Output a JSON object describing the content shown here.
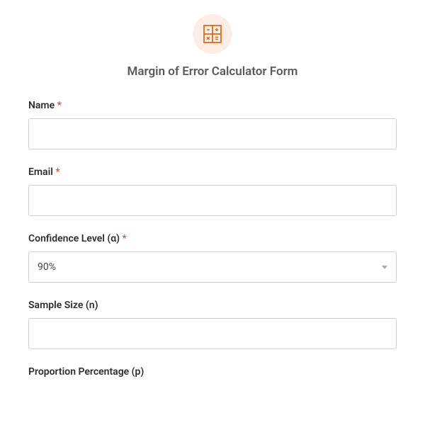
{
  "form": {
    "title": "Margin of Error Calculator Form",
    "fields": {
      "name": {
        "label": "Name",
        "required": true,
        "value": ""
      },
      "email": {
        "label": "Email",
        "required": true,
        "value": ""
      },
      "confidence": {
        "label": "Confidence Level (α)",
        "required": true,
        "selected": "90%"
      },
      "sampleSize": {
        "label": "Sample Size (n)",
        "required": false,
        "value": ""
      },
      "proportion": {
        "label": "Proportion Percentage (p)",
        "required": false
      }
    },
    "requiredMark": "*"
  }
}
